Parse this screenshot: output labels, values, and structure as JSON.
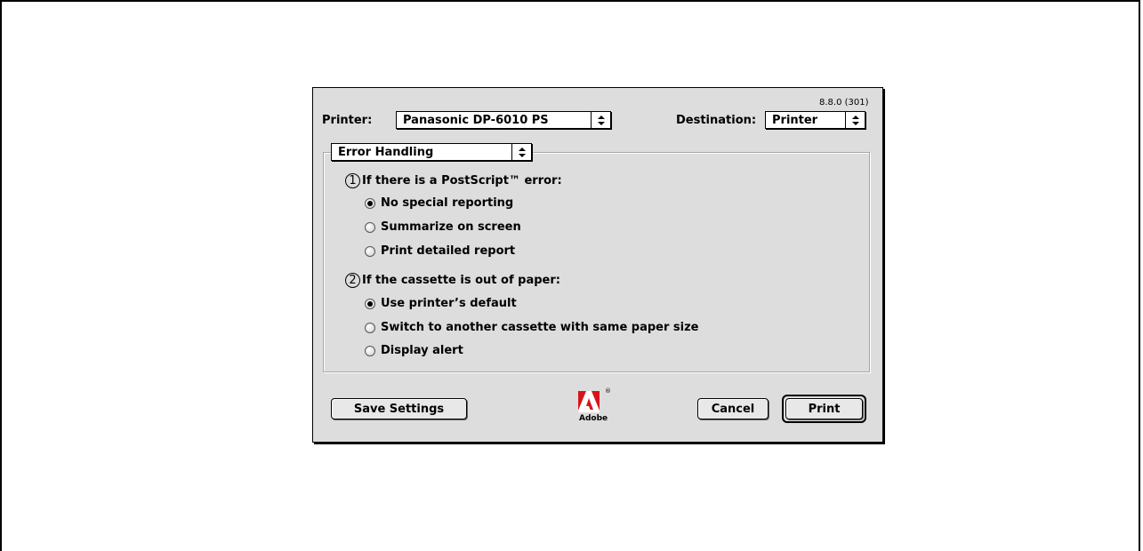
{
  "dialog": {
    "version": "8.8.0 (301)",
    "printer_label": "Printer:",
    "printer_value": "Panasonic DP-6010 PS",
    "destination_label": "Destination:",
    "destination_value": "Printer",
    "panel_value": "Error Handling"
  },
  "postscript": {
    "number": "1",
    "title": "If there is a PostScript™ error:",
    "options": [
      {
        "label": "No special reporting",
        "selected": true
      },
      {
        "label": "Summarize on screen",
        "selected": false
      },
      {
        "label": "Print detailed report",
        "selected": false
      }
    ]
  },
  "paper": {
    "number": "2",
    "title": "If the cassette is out of paper:",
    "options": [
      {
        "label": "Use printer’s default",
        "selected": true
      },
      {
        "label": "Switch to another cassette with same paper size",
        "selected": false
      },
      {
        "label": "Display alert",
        "selected": false
      }
    ]
  },
  "buttons": {
    "save": "Save Settings",
    "cancel": "Cancel",
    "print": "Print"
  },
  "logo": {
    "text": "Adobe",
    "mark": "®",
    "color": "#d7141a"
  }
}
